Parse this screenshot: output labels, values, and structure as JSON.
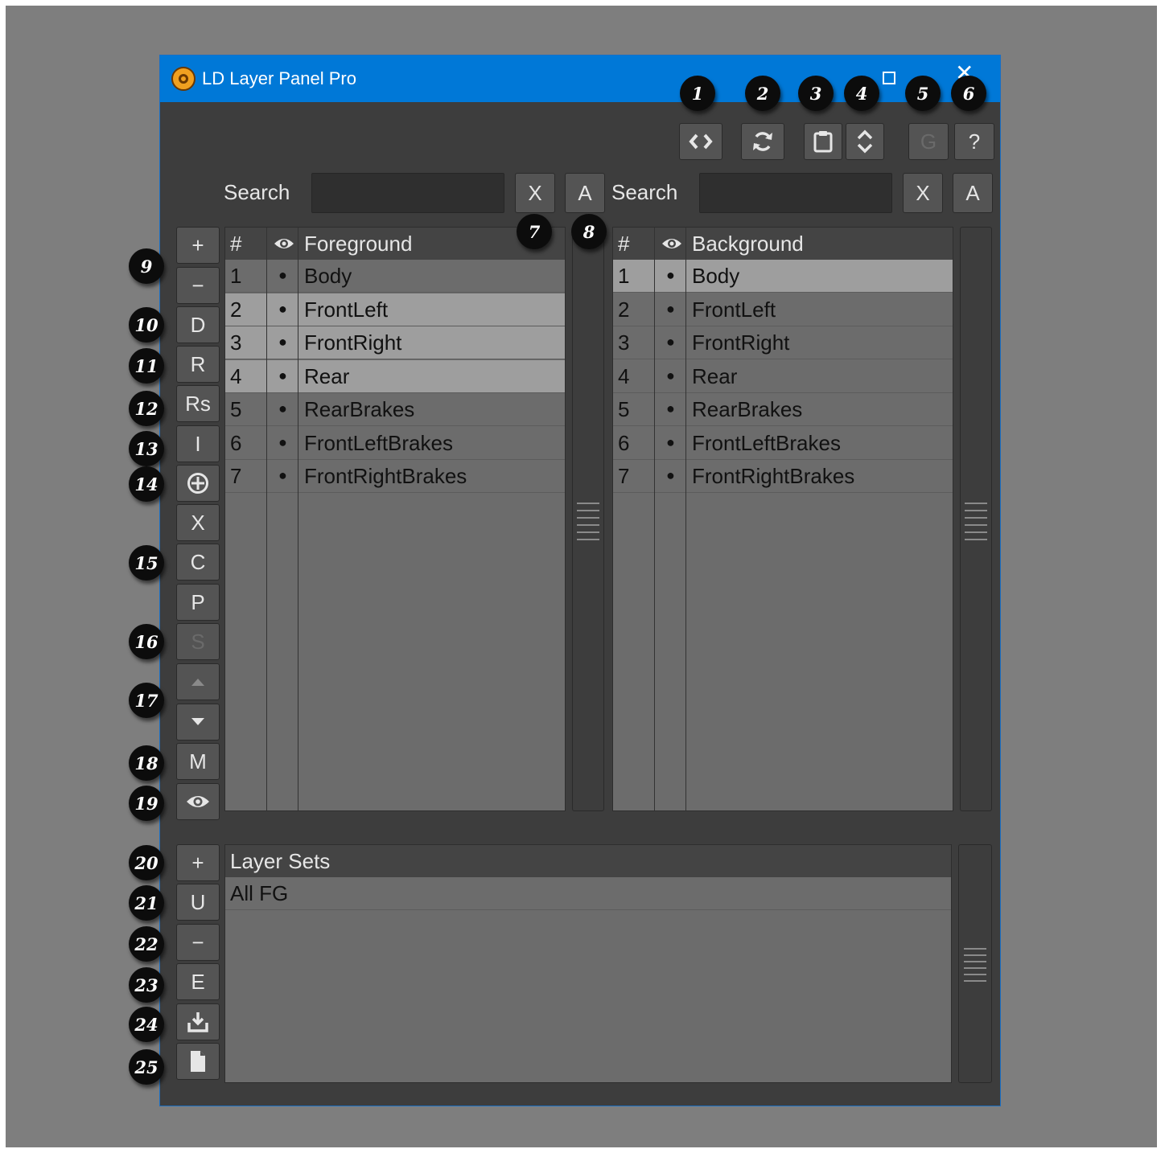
{
  "window": {
    "title": "LD Layer Panel Pro"
  },
  "toolbar": {
    "buttons": [
      {
        "icon": "code-swap-icon"
      },
      {
        "icon": "refresh-icon"
      },
      {
        "icon": "clipboard-icon"
      },
      {
        "icon": "expand-collapse-icon"
      },
      {
        "label": "G"
      },
      {
        "label": "?"
      }
    ]
  },
  "search_fg": {
    "label": "Search",
    "value": "",
    "clear_label": "X",
    "all_label": "A"
  },
  "search_bg": {
    "label": "Search",
    "value": "",
    "clear_label": "X",
    "all_label": "A"
  },
  "foreground": {
    "col_num": "#",
    "title": "Foreground",
    "bullet": "●",
    "rows": [
      {
        "num": "1",
        "name": "Body",
        "selected": false
      },
      {
        "num": "2",
        "name": "FrontLeft",
        "selected": true
      },
      {
        "num": "3",
        "name": "FrontRight",
        "selected": true
      },
      {
        "num": "4",
        "name": "Rear",
        "selected": true
      },
      {
        "num": "5",
        "name": "RearBrakes",
        "selected": false
      },
      {
        "num": "6",
        "name": "FrontLeftBrakes",
        "selected": false
      },
      {
        "num": "7",
        "name": "FrontRightBrakes",
        "selected": false
      }
    ]
  },
  "background": {
    "col_num": "#",
    "title": "Background",
    "bullet": "●",
    "rows": [
      {
        "num": "1",
        "name": "Body",
        "selected": true
      },
      {
        "num": "2",
        "name": "FrontLeft",
        "selected": false
      },
      {
        "num": "3",
        "name": "FrontRight",
        "selected": false
      },
      {
        "num": "4",
        "name": "Rear",
        "selected": false
      },
      {
        "num": "5",
        "name": "RearBrakes",
        "selected": false
      },
      {
        "num": "6",
        "name": "FrontLeftBrakes",
        "selected": false
      },
      {
        "num": "7",
        "name": "FrontRightBrakes",
        "selected": false
      }
    ]
  },
  "side_buttons": {
    "add": "+",
    "remove": "−",
    "d": "D",
    "r": "R",
    "rs": "Rs",
    "i": "I",
    "x": "X",
    "c": "C",
    "p": "P",
    "s": "S",
    "m": "M"
  },
  "layer_sets": {
    "title": "Layer Sets",
    "items": [
      "All FG"
    ],
    "buttons": {
      "add": "+",
      "u": "U",
      "remove": "−",
      "e": "E"
    }
  },
  "callouts": [
    "1",
    "2",
    "3",
    "4",
    "5",
    "6",
    "7",
    "8",
    "9",
    "10",
    "11",
    "12",
    "13",
    "14",
    "15",
    "16",
    "17",
    "18",
    "19",
    "20",
    "21",
    "22",
    "23",
    "24",
    "25"
  ],
  "colors": {
    "titlebar": "#0078d7",
    "panel": "#3d3d3d",
    "list": "#6c6c6c",
    "selected_row": "#9e9e9e"
  }
}
